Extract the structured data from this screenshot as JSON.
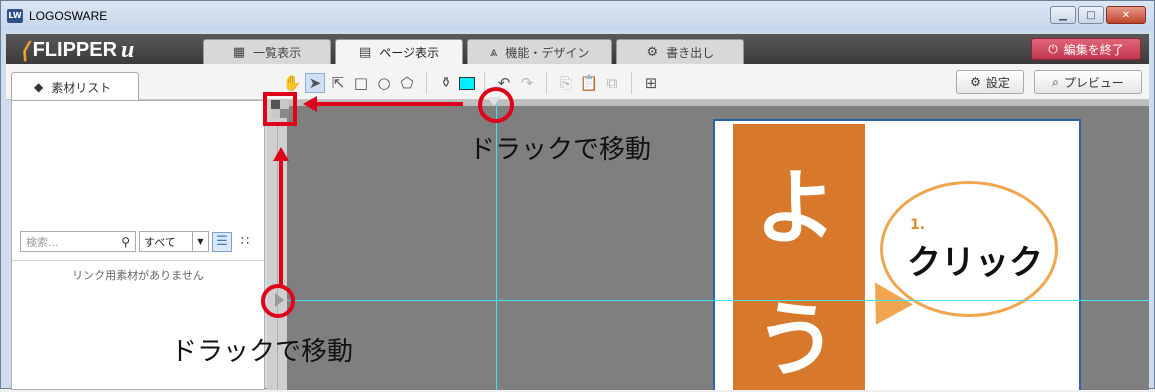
{
  "window": {
    "title": "LOGOSWARE",
    "icon": "app-logo-icon"
  },
  "appbar": {
    "logo_text": "FLIPPER",
    "logo_suffix": "u",
    "tabs": [
      {
        "label": "一覧表示",
        "icon": "grid-icon"
      },
      {
        "label": "ページ表示",
        "icon": "page-icon"
      },
      {
        "label": "機能・デザイン",
        "icon": "design-icon"
      },
      {
        "label": "書き出し",
        "icon": "export-gear-icon"
      }
    ],
    "exit_label": "編集を終了"
  },
  "toolbar": {
    "side_tab_label": "素材リスト",
    "settings_label": "設定",
    "preview_label": "プレビュー"
  },
  "left_panel": {
    "search_placeholder": "検索...",
    "filter_value": "すべて",
    "empty_message": "リンク用素材がありません"
  },
  "page_preview": {
    "char1": "よ",
    "char2": "う",
    "step_number": "1.",
    "click_text": "クリック"
  },
  "annotations": {
    "drag_top": "ドラックで移動",
    "drag_bottom": "ドラックで移動"
  },
  "colors": {
    "accent_red": "#e0001a",
    "guide_cyan": "#3ce3f0",
    "page_orange": "#d8782a",
    "exit_button": "#c23850"
  }
}
